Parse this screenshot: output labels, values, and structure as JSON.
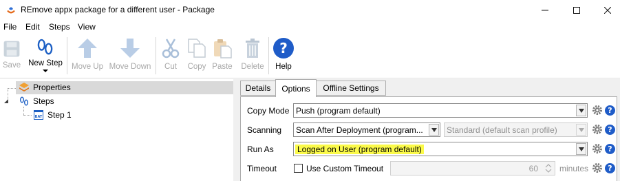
{
  "window": {
    "title": "REmove appx package for a different user - Package",
    "minimize": "—",
    "maximize": "☐",
    "close": "✕"
  },
  "menu": [
    "File",
    "Edit",
    "Steps",
    "View"
  ],
  "toolbar": {
    "save": "Save",
    "new_step": "New Step",
    "move_up": "Move Up",
    "move_down": "Move Down",
    "cut": "Cut",
    "copy": "Copy",
    "paste": "Paste",
    "delete": "Delete",
    "help": "Help"
  },
  "tree": {
    "properties": "Properties",
    "steps": "Steps",
    "step1": "Step 1"
  },
  "tabs": [
    {
      "label": "Details",
      "active": false
    },
    {
      "label": "Options",
      "active": true
    },
    {
      "label": "Offline Settings",
      "active": false
    }
  ],
  "options": {
    "copy_mode": {
      "label": "Copy Mode",
      "value": "Push (program default)"
    },
    "scanning": {
      "label": "Scanning",
      "value": "Scan After Deployment (program...",
      "profile": "Standard (default scan profile)"
    },
    "run_as": {
      "label": "Run As",
      "value": "Logged on User (program default)"
    },
    "timeout": {
      "label": "Timeout",
      "checkbox_label": "Use Custom Timeout",
      "value": "60",
      "unit": "minutes",
      "checked": false
    }
  },
  "colors": {
    "highlight": "#fbfa4a",
    "help_blue": "#1f5cc8",
    "selection": "#d9d9d9"
  }
}
